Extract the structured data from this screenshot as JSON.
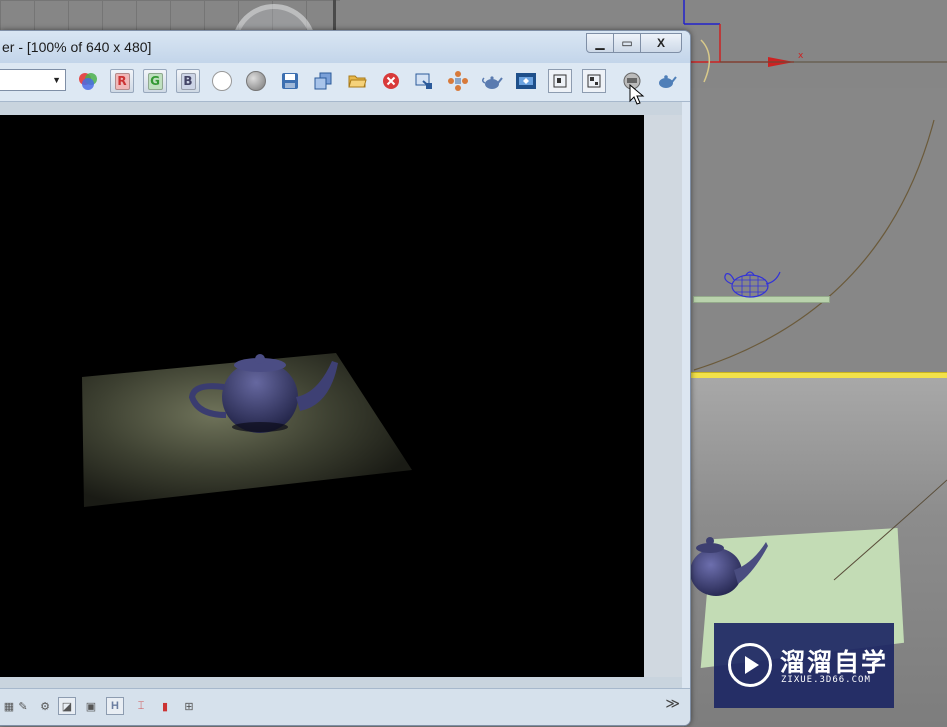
{
  "window": {
    "title": "er - [100% of 640 x 480]",
    "min_glyph": "▁",
    "max_glyph": "▭",
    "close_glyph": "X"
  },
  "toolbar": {
    "area_dropdown_value": "",
    "channel_red_label": "R",
    "channel_green_label": "G",
    "channel_blue_label": "B",
    "icons": [
      "color-picker-icon",
      "red-channel-toggle",
      "green-channel-toggle",
      "blue-channel-toggle",
      "white-circle-icon",
      "gray-circle-icon",
      "save-image-icon",
      "clone-frame-icon",
      "open-folder-icon",
      "clear-icon",
      "copy-image-icon",
      "network-render-icon",
      "teapot-render-icon",
      "display-channels-icon",
      "frame-a-icon",
      "frame-b-icon",
      "render-button-icon",
      "teapot-icon"
    ]
  },
  "bottombar": {
    "h_label": "H",
    "expand_glyph": "≫"
  },
  "scene": {
    "axis_x_label": "x"
  },
  "watermark": {
    "chinese": "溜溜自学",
    "url": "ZIXUE.3D66.COM"
  },
  "colors": {
    "title_bar": "#c3d5ea",
    "toolbar_bg": "#dde8f3",
    "viewport_gray": "#878787",
    "active_viewport_border": "#f2e14a",
    "floor_green": "#c3dcb5",
    "teapot_purple": "#4a4d80",
    "render_background": "#000000",
    "watermark_bg": "#1e2864"
  }
}
